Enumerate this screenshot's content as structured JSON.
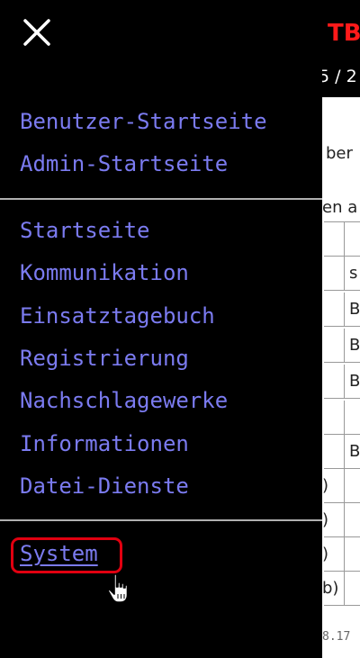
{
  "background": {
    "title_fragment": "TB",
    "date_fragment": "5 / 2",
    "text_fragments": [
      "ber",
      "en a"
    ],
    "table_cells": [
      "s",
      "B",
      "B",
      "B",
      "",
      "B"
    ],
    "table_left_fragments": [
      ")",
      ")",
      ")",
      "b)"
    ],
    "footer_fragment": "8.17"
  },
  "drawer": {
    "close_label": "close",
    "top_items": [
      {
        "label": "Benutzer-Startseite"
      },
      {
        "label": "Admin-Startseite"
      }
    ],
    "main_items": [
      {
        "label": "Startseite"
      },
      {
        "label": "Kommunikation"
      },
      {
        "label": "Einsatztagebuch"
      },
      {
        "label": "Registrierung"
      },
      {
        "label": "Nachschlagewerke"
      },
      {
        "label": "Informationen"
      },
      {
        "label": "Datei-Dienste"
      }
    ],
    "bottom_items": [
      {
        "label": "System",
        "highlighted": true
      }
    ]
  },
  "colors": {
    "link": "#7b7bf0",
    "highlight_border": "#e10010",
    "title_red": "#ff1a1a",
    "drawer_bg": "#000000",
    "divider": "#b0b0b0"
  },
  "icons": {
    "close": "close-icon",
    "cursor": "hand-pointer-icon"
  }
}
